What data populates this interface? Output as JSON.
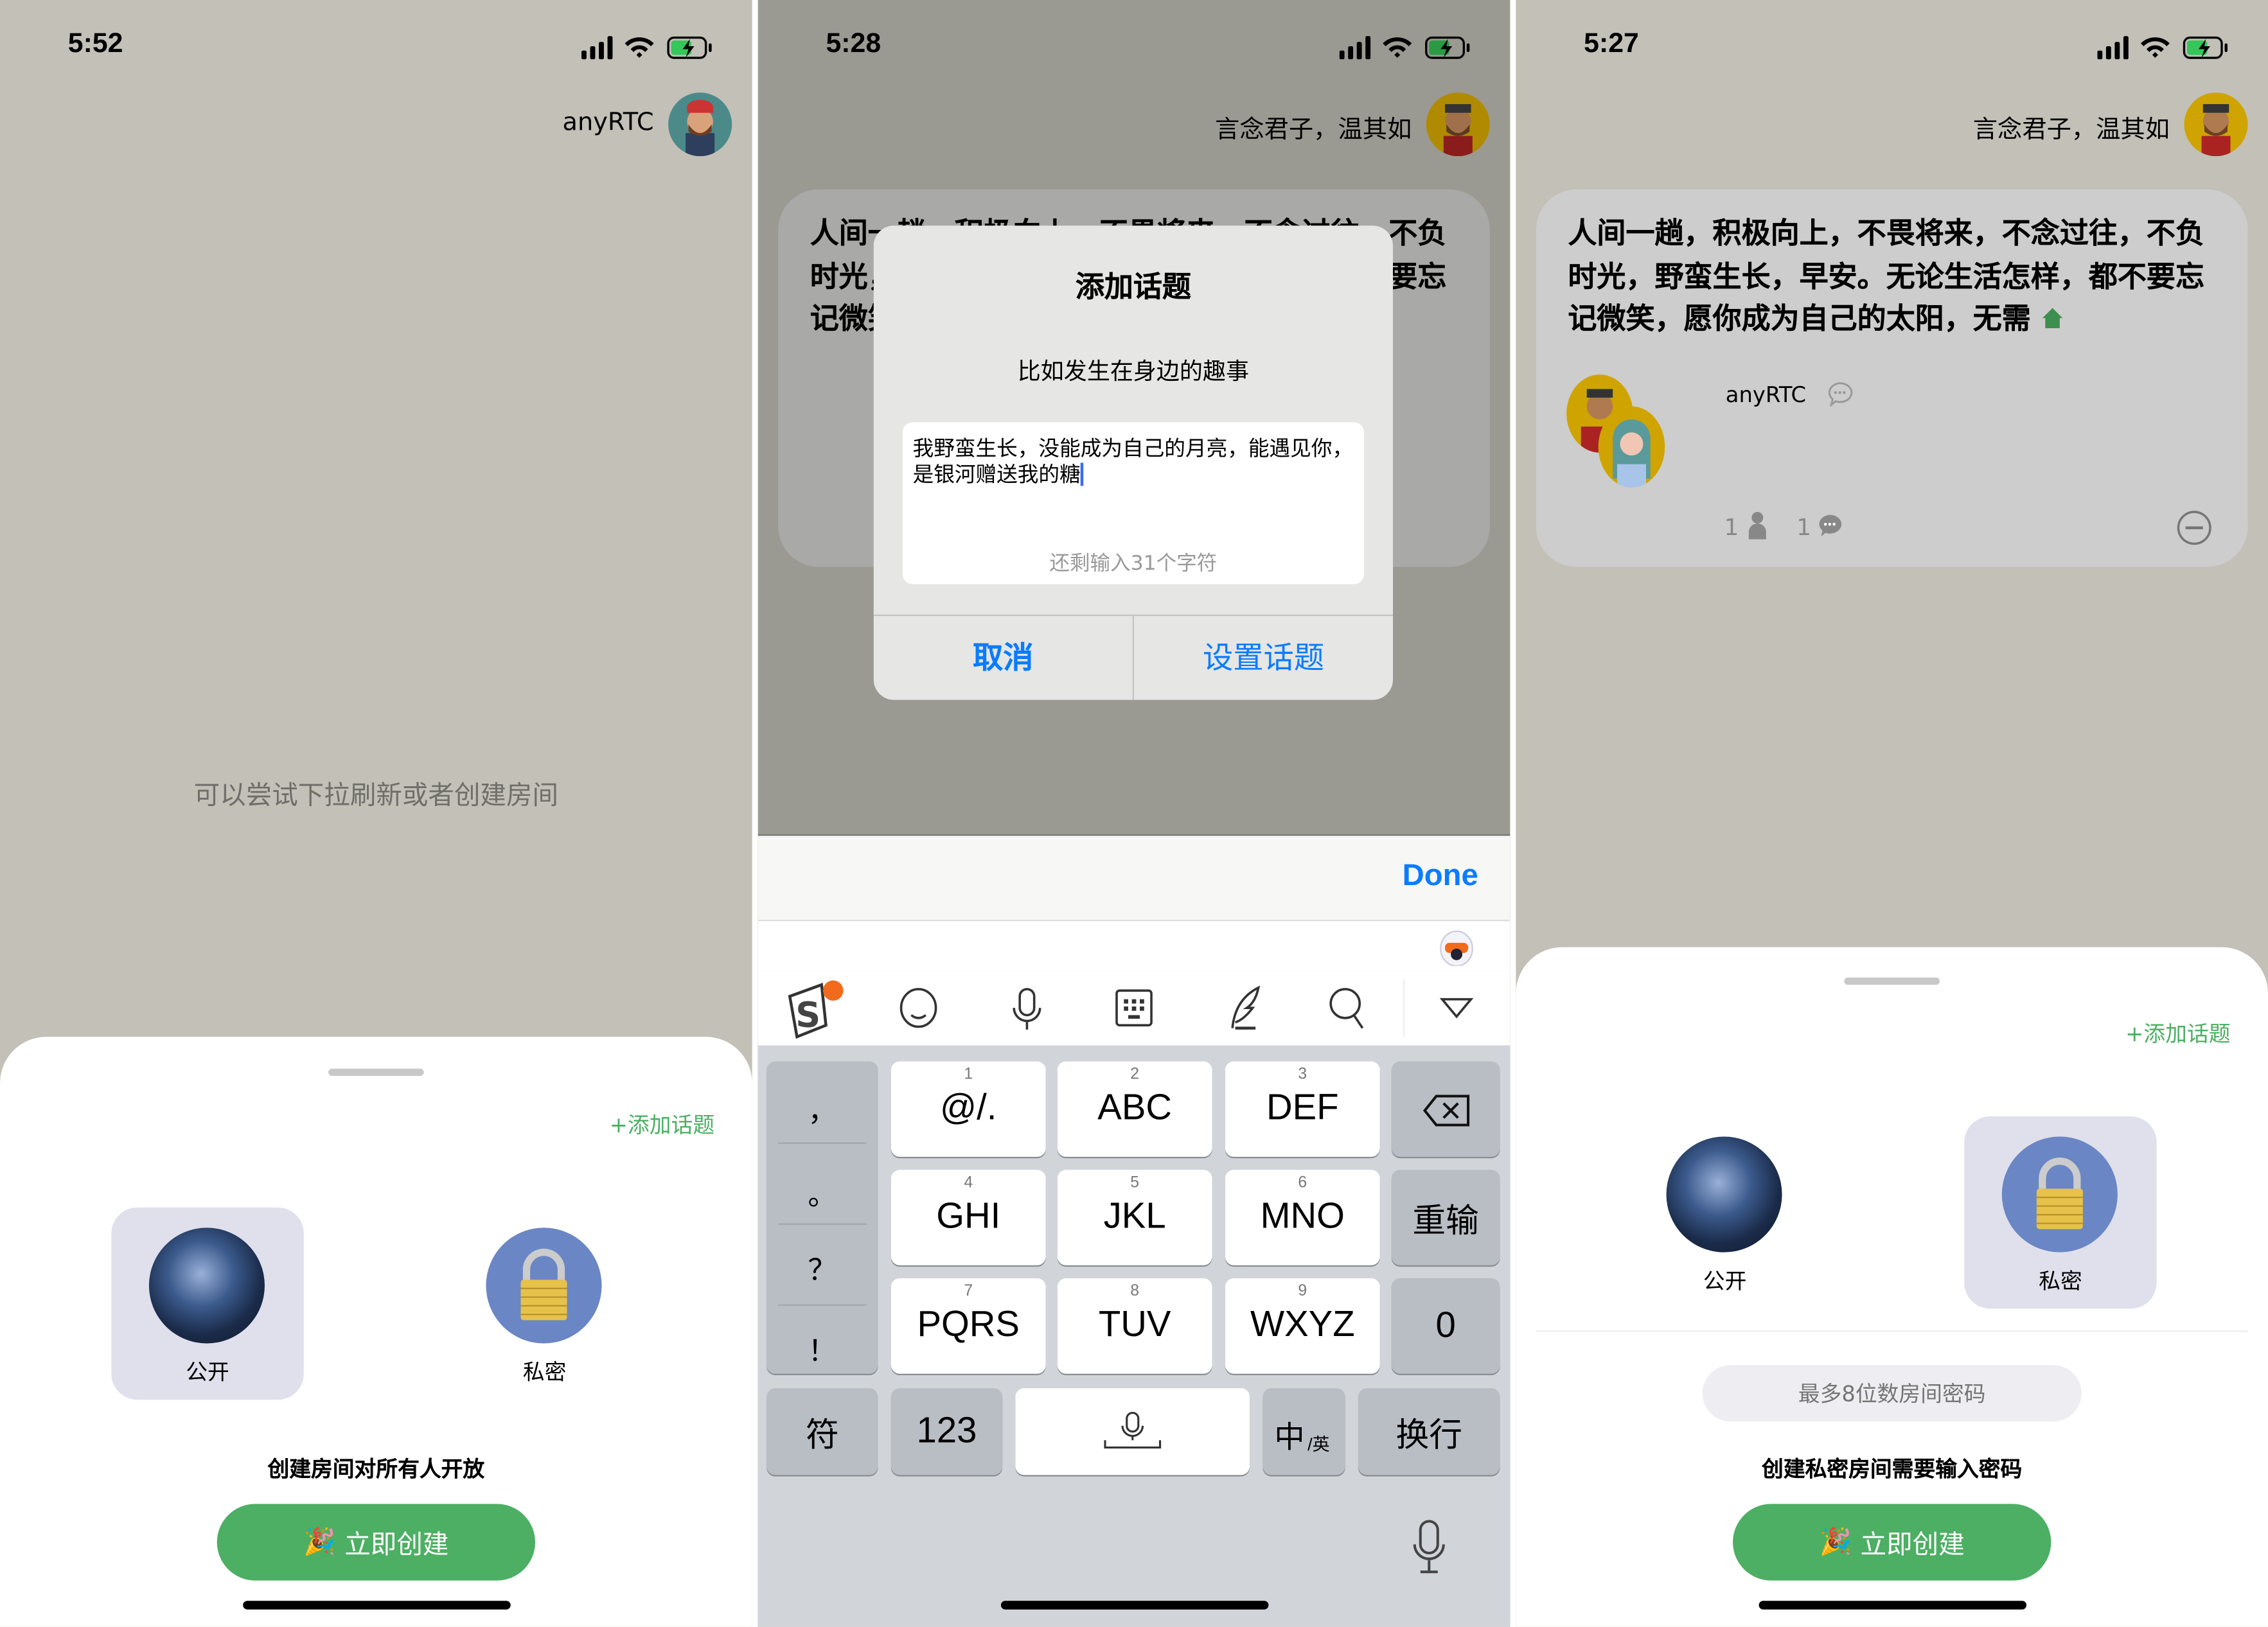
{
  "screens": [
    {
      "status": {
        "time": "5:52"
      },
      "header": {
        "user_name": "anyRTC"
      },
      "empty_message": "可以尝试下拉刷新或者创建房间",
      "sheet": {
        "add_topic": "+添加话题",
        "options": [
          {
            "label": "公开",
            "icon": "globe-icon",
            "selected": true
          },
          {
            "label": "私密",
            "icon": "lock-icon",
            "selected": false
          }
        ],
        "description": "创建房间对所有人开放",
        "create_button": "立即创建"
      }
    },
    {
      "status": {
        "time": "5:28"
      },
      "header": {
        "user_name": "言念君子，温其如"
      },
      "background_card_text": "人间一趟，积极向上，不畏将来，不念过往，不负时光，野蛮生长，早安。无论生活怎样，都不要忘记微笑",
      "dialog": {
        "title": "添加话题",
        "subtitle": "比如发生在身边的趣事",
        "input_value": "我野蛮生长，没能成为自己的月亮，能遇见你，是银河赠送我的糖",
        "counter": "还剩输入31个字符",
        "cancel": "取消",
        "confirm": "设置话题"
      },
      "keyboard": {
        "done": "Done",
        "punctuation": [
          "，",
          "。",
          "？",
          "！"
        ],
        "keys": [
          {
            "num": "1",
            "label": "@/."
          },
          {
            "num": "2",
            "label": "ABC"
          },
          {
            "num": "3",
            "label": "DEF"
          },
          {
            "num": "4",
            "label": "GHI"
          },
          {
            "num": "5",
            "label": "JKL"
          },
          {
            "num": "6",
            "label": "MNO"
          },
          {
            "num": "7",
            "label": "PQRS"
          },
          {
            "num": "8",
            "label": "TUV"
          },
          {
            "num": "9",
            "label": "WXYZ"
          }
        ],
        "reenter": "重输",
        "zero": "0",
        "symbols": "符",
        "numbers": "123",
        "lang": "中",
        "lang_sub": "/英",
        "return": "换行"
      }
    },
    {
      "status": {
        "time": "5:27"
      },
      "header": {
        "user_name": "言念君子，温其如"
      },
      "room_card": {
        "text": "人间一趟，积极向上，不畏将来，不念过往，不负时光，野蛮生长，早安。无论生活怎样，都不要忘记微笑，愿你成为自己的太阳，无需",
        "host": "anyRTC",
        "member_count": "1",
        "message_count": "1"
      },
      "sheet": {
        "add_topic": "+添加话题",
        "options": [
          {
            "label": "公开",
            "icon": "globe-icon",
            "selected": false
          },
          {
            "label": "私密",
            "icon": "lock-icon",
            "selected": true
          }
        ],
        "password_placeholder": "最多8位数房间密码",
        "description": "创建私密房间需要输入密码",
        "create_button": "立即创建"
      }
    }
  ],
  "colors": {
    "accent_green": "#4caf63",
    "ios_blue": "#0a7cff",
    "background": "#c3c0b8"
  }
}
